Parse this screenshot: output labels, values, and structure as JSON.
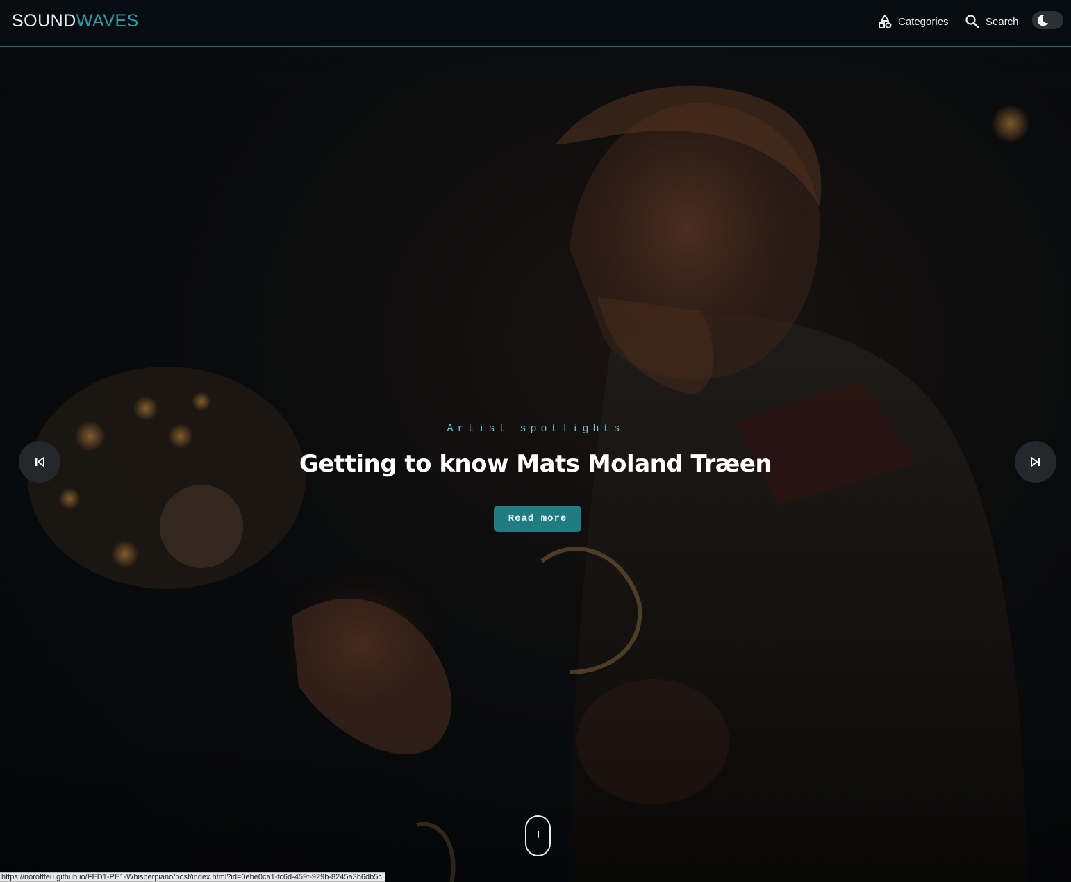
{
  "header": {
    "logo_part1": "SOUND",
    "logo_part2": "WAVES",
    "nav": {
      "categories_label": "Categories",
      "search_label": "Search"
    },
    "theme_toggle_icon": "moon-icon"
  },
  "hero": {
    "category": "Artist spotlights",
    "title": "Getting to know Mats Moland Træen",
    "read_more_label": "Read more",
    "prev_icon": "skip-previous-icon",
    "next_icon": "skip-next-icon",
    "scroll_icon": "mouse-scroll-icon"
  },
  "status_bar": {
    "url": "https://norofffeu.github.io/FED1-PE1-Whisperpiano/post/index.html?id=0ebe0ca1-fc6d-459f-929b-8245a3b6db5c"
  },
  "colors": {
    "accent": "#1f7c80",
    "accent_light": "#2e9ea6",
    "category_text": "#6fc3c6",
    "header_bg": "#060c11"
  }
}
